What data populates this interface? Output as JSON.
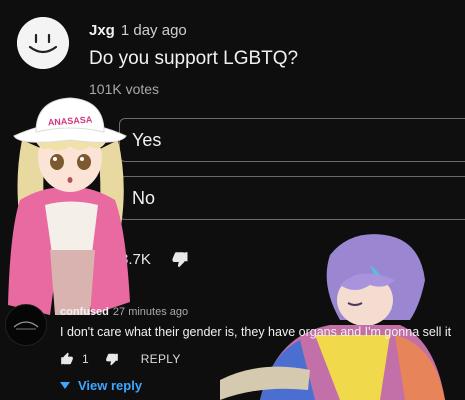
{
  "post": {
    "author": "Jxg",
    "time": "1 day ago",
    "question": "Do you support LGBTQ?",
    "votes": "101K votes",
    "options": [
      "Yes",
      "No"
    ],
    "likes": "3.7K",
    "avatar_icon": "smiley-face-icon"
  },
  "overlays": {
    "hat_text": "ANASASA"
  },
  "reply": {
    "author": "confused",
    "time": "27 minutes ago",
    "text": "I don't care what their gender is, they have organs and I'm gonna sell it",
    "likes": "1",
    "reply_label": "REPLY",
    "view_reply_label": "View reply"
  },
  "colors": {
    "background": "#0e0e0e",
    "link": "#3ea6ff",
    "option_border": "#6b6b6b"
  }
}
